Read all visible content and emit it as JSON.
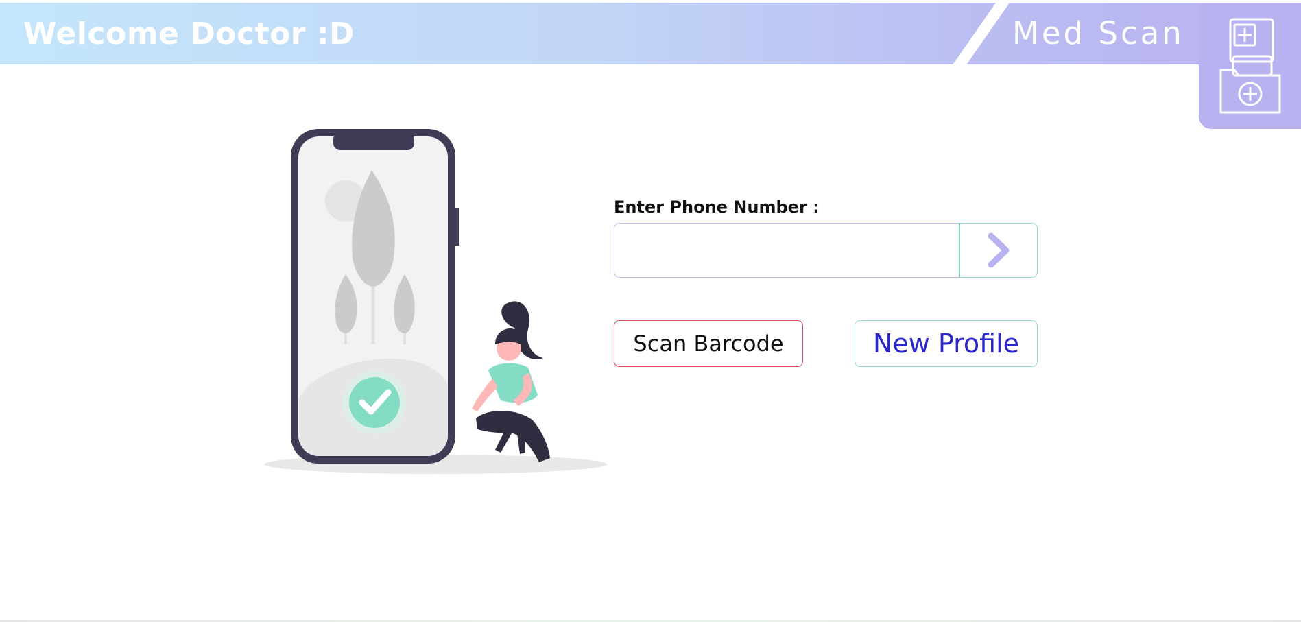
{
  "header": {
    "title": "Welcome Doctor :D",
    "brand": "Med Scan",
    "gradient_start": "#c4e6fb",
    "gradient_end": "#b9b2f0",
    "logo_icon": "medical-folder-icon"
  },
  "form": {
    "phone_label": "Enter Phone Number :",
    "phone_value": "",
    "phone_placeholder": "",
    "submit_icon": "chevron-right-icon",
    "scan_button_label": "Scan Barcode",
    "new_profile_button_label": "New Profile"
  },
  "colors": {
    "accent_purple": "#b9b2f0",
    "accent_mint": "#8fdcc4",
    "scan_border": "#d84a5a",
    "profile_text": "#2b27c9",
    "check_green": "#84dcc4"
  },
  "illustration": {
    "name": "phone-verified-illustration"
  }
}
